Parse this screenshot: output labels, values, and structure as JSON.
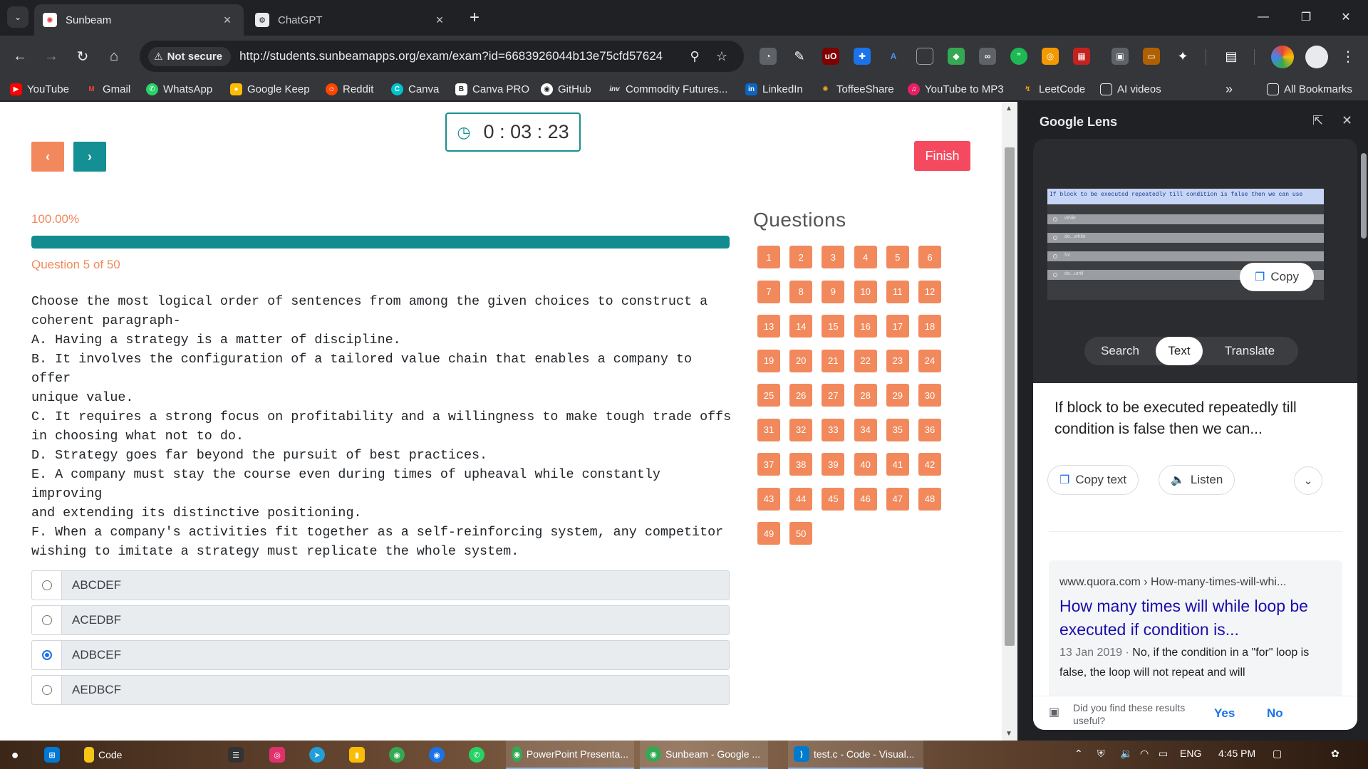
{
  "browser": {
    "tabs": [
      {
        "title": "Sunbeam",
        "active": true
      },
      {
        "title": "ChatGPT",
        "active": false
      }
    ],
    "new_tab": "+",
    "tab_close": "×",
    "address": {
      "security_label": "Not secure",
      "url": "http://students.sunbeamapps.org/exam/exam?id=6683926044b13e75cfd57624"
    },
    "window_controls": {
      "minimize": "—",
      "restore": "❐",
      "close": "✕"
    },
    "bookmarks": [
      {
        "label": "YouTube",
        "icon": "youtube-icon",
        "color": "#ff0000"
      },
      {
        "label": "Gmail",
        "icon": "gmail-icon",
        "color": "#ea4335"
      },
      {
        "label": "WhatsApp",
        "icon": "whatsapp-icon",
        "color": "#25d366"
      },
      {
        "label": "Google Keep",
        "icon": "keep-icon",
        "color": "#fbbc04"
      },
      {
        "label": "Reddit",
        "icon": "reddit-icon",
        "color": "#ff4500"
      },
      {
        "label": "Canva",
        "icon": "canva-icon",
        "color": "#00c4cc"
      },
      {
        "label": "Canva PRO",
        "icon": "canva-pro-icon",
        "color": "#202124"
      },
      {
        "label": "GitHub",
        "icon": "github-icon",
        "color": "#ffffff"
      },
      {
        "label": "Commodity Futures...",
        "icon": "investing-icon",
        "color": "#202124"
      },
      {
        "label": "LinkedIn",
        "icon": "linkedin-icon",
        "color": "#0a66c2"
      },
      {
        "label": "ToffeeShare",
        "icon": "toffeeshare-icon",
        "color": "#f5a623"
      },
      {
        "label": "YouTube to MP3",
        "icon": "music-icon",
        "color": "#e91e63"
      },
      {
        "label": "LeetCode",
        "icon": "leetcode-icon",
        "color": "#ffa116"
      },
      {
        "label": "AI videos",
        "icon": "folder-icon",
        "color": "#e8eaed"
      }
    ],
    "bookmarks_overflow": "»",
    "all_bookmarks": "All Bookmarks"
  },
  "exam": {
    "timer": "0 : 03 : 23",
    "prev_label": "‹",
    "next_label": "›",
    "finish_label": "Finish",
    "progress_label": "100.00%",
    "progress_fraction": 1.0,
    "question_counter": "Question 5 of 50",
    "question_text": "Choose the most logical order of sentences from among the given choices to construct a\ncoherent paragraph-\nA. Having a strategy is a matter of discipline.\nB. It involves the configuration of a tailored value chain that enables a company to offer\nunique value.\nC. It requires a strong focus on profitability and a willingness to make tough trade offs\nin choosing what not to do.\nD. Strategy goes far beyond the pursuit of best practices.\nE. A company must stay the course even during times of upheaval while constantly improving\nand extending its distinctive positioning.\nF. When a company's activities fit together as a self-reinforcing system, any competitor\nwishing to imitate a strategy must replicate the whole system.",
    "options": [
      {
        "label": "ABCDEF",
        "selected": false
      },
      {
        "label": "ACEDBF",
        "selected": false
      },
      {
        "label": "ADBCEF",
        "selected": true
      },
      {
        "label": "AEDBCF",
        "selected": false
      }
    ],
    "questions_heading": "Questions",
    "question_numbers": [
      "1",
      "2",
      "3",
      "4",
      "5",
      "6",
      "7",
      "8",
      "9",
      "10",
      "11",
      "12",
      "13",
      "14",
      "15",
      "16",
      "17",
      "18",
      "19",
      "20",
      "21",
      "22",
      "23",
      "24",
      "25",
      "26",
      "27",
      "28",
      "29",
      "30",
      "31",
      "32",
      "33",
      "34",
      "35",
      "36",
      "37",
      "38",
      "39",
      "40",
      "41",
      "42",
      "43",
      "44",
      "45",
      "46",
      "47",
      "48",
      "49",
      "50"
    ],
    "accent_orange": "#f2895c",
    "accent_teal": "#148f93",
    "finish_red": "#f4495f"
  },
  "lens": {
    "title": "Google Lens",
    "image_selected_text": "If block to be executed repeatedly till condition is false then we can use",
    "image_options": [
      "while",
      "do...while",
      "for",
      "do...until"
    ],
    "copy_label": "Copy",
    "tabs": [
      "Search",
      "Text",
      "Translate"
    ],
    "active_tab": "Text",
    "extracted_text": "If block to be executed repeatedly till condition is false then we can...",
    "copy_text_label": "Copy text",
    "listen_label": "Listen",
    "result": {
      "source": "www.quora.com › How-many-times-will-whi...",
      "title": "How many times will while loop be executed if condition is...",
      "date": "13 Jan 2019",
      "snippet": "No, if the condition in a \"for\" loop is false, the loop will not repeat and will"
    },
    "feedback_question": "Did you find these results useful?",
    "yes_label": "Yes",
    "no_label": "No"
  },
  "taskbar": {
    "pinned_code_label": "Code",
    "windows": [
      {
        "label": "PowerPoint Presenta...",
        "icon": "chrome-icon"
      },
      {
        "label": "Sunbeam - Google ...",
        "icon": "chrome-icon"
      },
      {
        "label": "test.c - Code - Visual...",
        "icon": "vscode-icon"
      }
    ],
    "language": "ENG",
    "time": "4:45 PM"
  }
}
